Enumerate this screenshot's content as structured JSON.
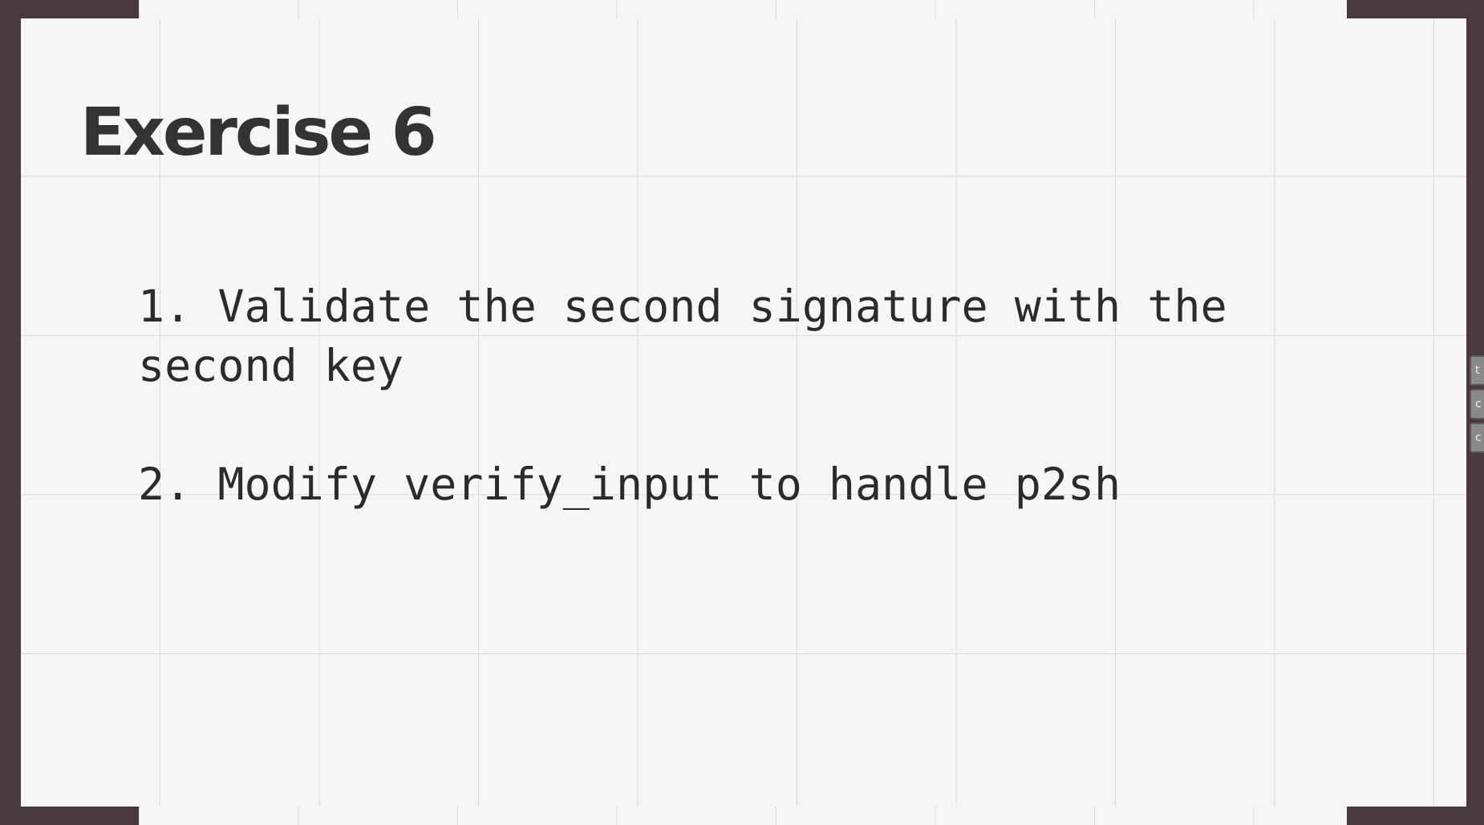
{
  "slide": {
    "title": "Exercise 6",
    "items": [
      "1. Validate the second signature with the second key",
      "2. Modify verify_input to handle p2sh"
    ]
  },
  "side_controls": [
    {
      "icon": "side-tab-1-icon",
      "glyph": "t"
    },
    {
      "icon": "side-tab-2-icon",
      "glyph": "c"
    },
    {
      "icon": "side-tab-3-icon",
      "glyph": "c"
    }
  ],
  "colors": {
    "frame": "#4a3840",
    "slide_background": "#f6f6f6",
    "grid_line": "#dcdcdc",
    "text": "#333333"
  }
}
